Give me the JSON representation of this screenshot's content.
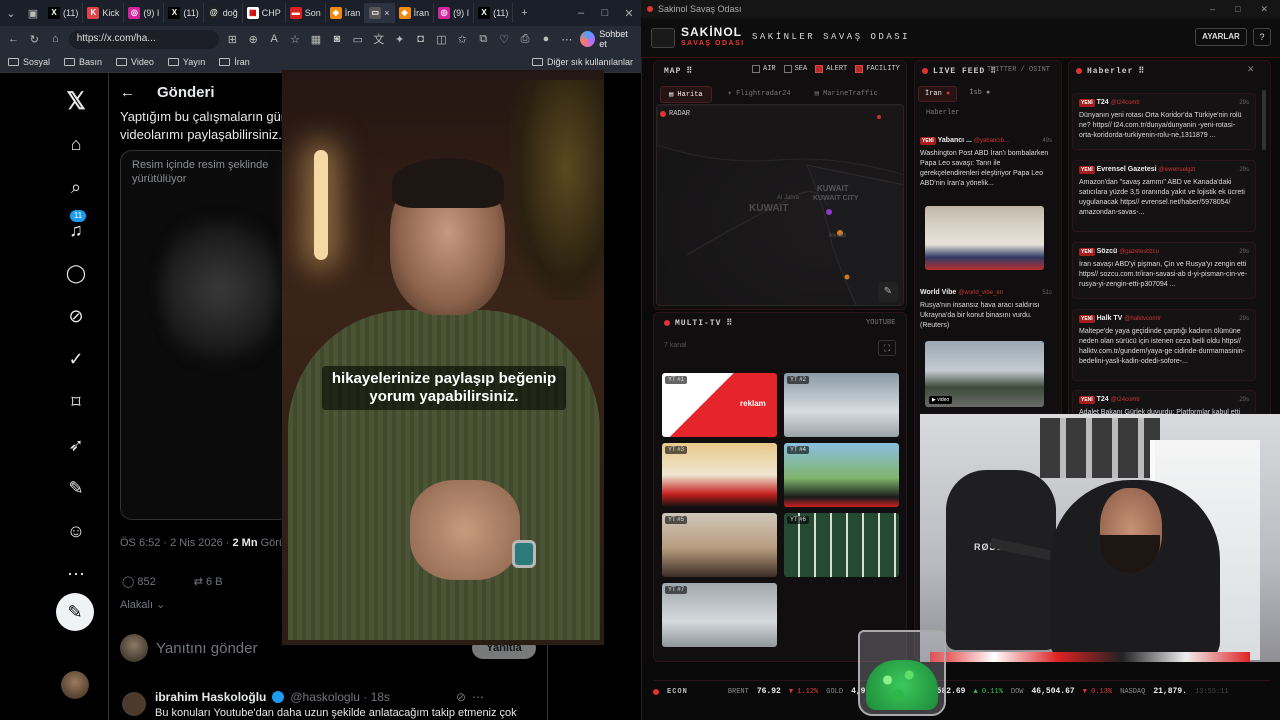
{
  "browser": {
    "tabs": [
      {
        "icon": "x-icon",
        "label": "(11)"
      },
      {
        "icon": "kick-icon",
        "label": "Kick"
      },
      {
        "icon": "instagram-icon",
        "label": "(9) I"
      },
      {
        "icon": "x-icon",
        "label": "(11)"
      },
      {
        "icon": "threads-icon",
        "label": "doğ"
      },
      {
        "icon": "chp-icon",
        "label": "CHP"
      },
      {
        "icon": "news-icon",
        "label": "Son"
      },
      {
        "icon": "news-icon",
        "label": "İran"
      },
      {
        "icon": "window-icon",
        "label": "×"
      },
      {
        "icon": "news-icon",
        "label": "İran"
      },
      {
        "icon": "instagram-icon",
        "label": "(9) I"
      },
      {
        "icon": "x-icon",
        "label": "(11)"
      }
    ],
    "url": "https://x.com/ha...",
    "chat_button": "Sohbet et",
    "bookmarks": [
      "Sosyal",
      "Basın",
      "Video",
      "Yayın",
      "İran"
    ],
    "other_bookmarks": "Diğer sık kullanılanlar"
  },
  "x": {
    "notification_count": "11",
    "header_title": "Gönderi",
    "tweet_text_line1": "Yaptığım bu çalışmaların gün",
    "tweet_text_line2": "videolarımı paylaşabilirsiniz.",
    "pip_text": "Resim içinde resim şeklinde yürütülüyor",
    "meta_time": "ÖS 6:52 · 2 Nis 2026 · ",
    "meta_views": "2 Mn",
    "meta_suffix": " Görü",
    "replies": "852",
    "reposts": "6 B",
    "sort_label": "Alakalı",
    "reply_placeholder": "Yanıtını gönder",
    "reply_button": "Yanıtla",
    "reply_author": "ibrahim Haskoloğlu",
    "reply_handle": "@haskologlu · 18s",
    "reply_text": "Bu konuları Youtube'dan daha uzun şekilde anlatacağım takip etmeniz çok"
  },
  "video": {
    "caption": "hikayelerinize paylaşıp beğenip yorum yapabilirsiniz."
  },
  "app": {
    "window_title": "Sakinol Savaş Odası",
    "brand": "SAKİNOL",
    "brand_sub": "SAVAŞ ODASI",
    "header_title": "SAKİNLER SAVAŞ ODASI",
    "settings_button": "AYARLAR",
    "help_button": "?",
    "map": {
      "title": "MAP",
      "flags": [
        {
          "label": "AIR",
          "on": false
        },
        {
          "label": "SEA",
          "on": false
        },
        {
          "label": "ALERT",
          "on": true
        },
        {
          "label": "FACILITY",
          "on": true
        }
      ],
      "tabs": [
        "Harita",
        "Flightradar24",
        "MarineTraffic"
      ],
      "radar": "RADAR",
      "places": [
        "KUWAIT",
        "KUWAIT CITY",
        "Al Jahra",
        "Ahmadi"
      ]
    },
    "multitv": {
      "title": "MULTI-TV",
      "source": "YOUTUBE",
      "sub": "7 kanal",
      "channels": [
        "YT #1",
        "YT #2",
        "YT #3",
        "YT #4",
        "YT #5",
        "YT #6",
        "YT #7"
      ],
      "ch1_text": "reklam"
    },
    "feed": {
      "title": "LIVE FEED",
      "sub": "TWITTER / OSINT",
      "tabs": [
        "İran",
        "İsb"
      ],
      "subtab": "Haberler",
      "cards": [
        {
          "badge": "YENİ",
          "source": "Yabancı ...",
          "handle": "@yabancib...",
          "time": "49s",
          "text": "Washington Post ABD İran'ı bombalarken Papa Leo savaşı: Tanrı ile gerekçelendirenleri eleştiriyor Papa Leo ABD'nin İran'a yönelik..."
        },
        {
          "badge": "",
          "source": "World Vibe",
          "handle": "@world_vibe_en",
          "time": "51s",
          "text": "Rusya'nın insansız hava aracı saldırısı Ukrayna'da bir konut binasını vurdu. (Reuters)"
        }
      ],
      "video_label": "▶ video"
    },
    "news": {
      "title": "Haberler",
      "items": [
        {
          "badge": "YENİ",
          "source": "T24",
          "handle": "@t24comtr",
          "time": "29s",
          "text": "Dünyanın yeni rotası Orta Koridor'da Türkiye'nin rolü ne? https// t24.com.tr/dunya/dunyanin -yeni-rotasi-orta-koridorda-turkiyenin-rolu-ne,1311879 ..."
        },
        {
          "badge": "YENİ",
          "source": "Evrensel Gazetesi",
          "handle": "@evrenselgzt",
          "time": "29s",
          "text": "Amazon'dan \"savaş zammı\" ABD ve Kanada'daki satıcılara yüzde 3,5 oranında yakıt ve lojistik ek ücreti uygulanacak https// evrensel.net/haber/5978054/ amazondan-savas-..."
        },
        {
          "badge": "YENİ",
          "source": "Sözcü",
          "handle": "@gazetesozcu",
          "time": "29s",
          "text": "İran savaşı ABD'yi pişman, Çin ve Rusya'yı zengin etti https// sozcu.com.tr/iran-savasi-ab d-yi-pisman-cin-ve-rusya-yi-zengin-etti-p307094 ..."
        },
        {
          "badge": "YENİ",
          "source": "Halk TV",
          "handle": "@halktvcomtr",
          "time": "29s",
          "text": "Maltepe'de yaya geçidinde çarptığı kadının ölümüne neden olan sürücü için istenen ceza belli oldu https// halktv.com.tr/gundem/yaya-ge cidinde-durmamasinin-bedelini-yasli-kadin-odedi-sofore-..."
        },
        {
          "badge": "YENİ",
          "source": "T24",
          "handle": "@t24comtr",
          "time": "29s",
          "text": "Adalet Bakanı Gürlek duyurdu: Platformlar kabul etti"
        }
      ]
    },
    "econ": {
      "title": "ECON",
      "items": [
        {
          "label": "BRENT",
          "value": "76.92",
          "change": "▼ 1.12%",
          "dir": "dn"
        },
        {
          "label": "GOLD",
          "value": "4,910",
          "change": "",
          "dir": "up"
        },
        {
          "label": "",
          "value": "6,582.69",
          "change": "▲ 0.11%",
          "dir": "up"
        },
        {
          "label": "DOW",
          "value": "46,504.67",
          "change": "▼ 0.13%",
          "dir": "dn"
        },
        {
          "label": "NASDAQ",
          "value": "21,879.",
          "change": "",
          "dir": "up"
        }
      ],
      "clock": "13:55:11"
    },
    "webcam": {
      "chair_brand": "RØDE"
    }
  }
}
